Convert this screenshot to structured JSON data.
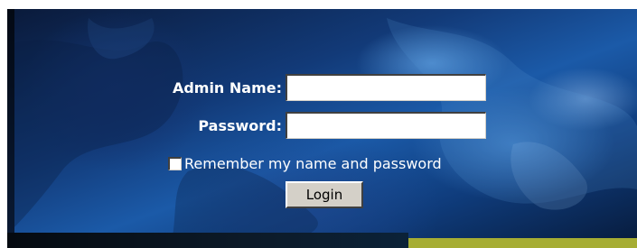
{
  "login_form": {
    "admin_name_label": "Admin Name:",
    "admin_name_value": "",
    "password_label": "Password:",
    "password_value": "",
    "remember_label": "Remember my name and password",
    "remember_checked": false,
    "login_button_label": "Login"
  },
  "colors": {
    "banner_blue": "#1b5aa8",
    "label_text": "#ffffff",
    "bottom_accent": "#a6ad33",
    "button_face": "#d4d0c8"
  }
}
